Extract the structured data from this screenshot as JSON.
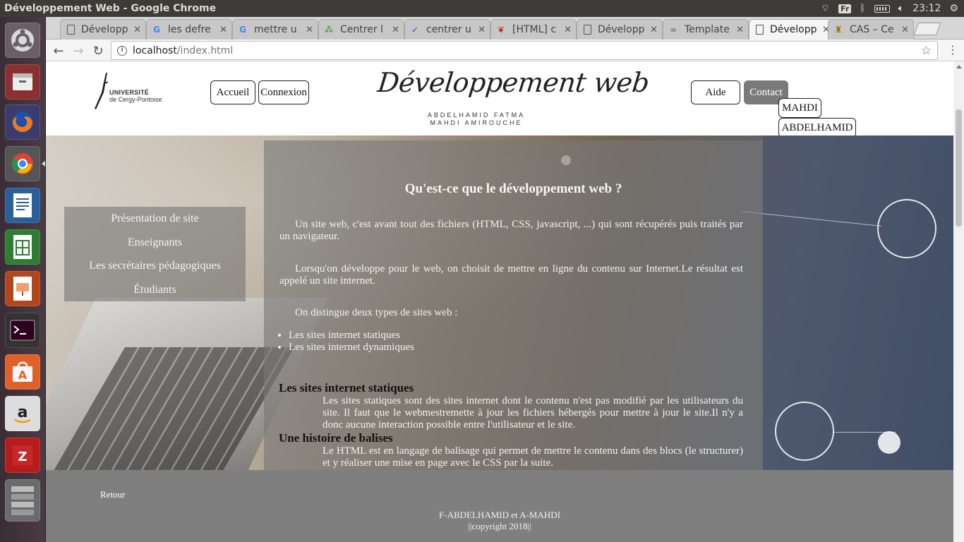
{
  "os": {
    "window_title": "Développement Web - Google Chrome",
    "keyboard_layout": "Fr",
    "clock": "23:12"
  },
  "browser": {
    "tabs": [
      {
        "label": "Développ",
        "icon": "document-icon",
        "active": false
      },
      {
        "label": "les defre",
        "icon": "google-icon",
        "active": false
      },
      {
        "label": "mettre u",
        "icon": "google-icon",
        "active": false
      },
      {
        "label": "Centrer l",
        "icon": "dots-icon",
        "active": false
      },
      {
        "label": "centrer u",
        "icon": "check-icon",
        "active": false
      },
      {
        "label": "[HTML] c",
        "icon": "feather-icon",
        "active": false
      },
      {
        "label": "Développ",
        "icon": "document-icon",
        "active": false
      },
      {
        "label": "Template",
        "icon": "mask-icon",
        "active": false
      },
      {
        "label": "Développ",
        "icon": "document-icon",
        "active": true
      },
      {
        "label": "CAS – Ce",
        "icon": "castle-icon",
        "active": false
      }
    ],
    "address": {
      "host": "localhost",
      "path": "/index.html"
    }
  },
  "site": {
    "logo": {
      "line1": "UNIVERSITÉ",
      "line2": "de Cergy-Pontoise"
    },
    "nav_left": {
      "home": "Accueil",
      "login": "Connexion"
    },
    "brand_title": "Développement web",
    "authors": [
      "ABDELHAMID FATMA",
      "MAHDI AMIROUCHE"
    ],
    "nav_right": {
      "help": "Aide",
      "contact": "Contact",
      "user1": "MAHDI",
      "user2": "ABDELHAMID"
    },
    "side_menu": [
      "Présentation de site",
      "Enseignants",
      "Les secrétaires pédagogiques",
      "Étudiants"
    ],
    "content": {
      "heading": "Qu'est-ce que le développement web ?",
      "p1": "Un site web, c'est avant tout des fichiers (HTML, CSS, javascript, ...) qui sont récupérés puis traités par un navigateur.",
      "p2": "Lorsqu'on développe pour le web, on choisit de mettre en ligne du contenu sur Internet.Le résultat est appelé un site internet.",
      "p3": "On distingue deux types de sites web :",
      "list": [
        "Les sites internet statiques",
        "Les sites internet dynamiques"
      ],
      "h_static": "Les sites internet statiques",
      "static_text": "Les sites statiques sont des sites internet dont le contenu n'est pas modifié par les utilisateurs du site. Il faut que le webmestremette à jour les fichiers hébergés pour mettre à jour le site.Il n'y a donc aucune interaction possible entre l'utilisateur et le site.",
      "h_tags": "Une histoire de balises",
      "tags_text": "Le HTML est en langage de balisage qui permet de mettre le contenu dans des blocs (le structurer) et y réaliser une mise en page avec le CSS par la suite."
    },
    "footer": {
      "back": "Retour",
      "credits": "F-ABDELHAMID et A-MAHDI",
      "copyright": "||copyright 2018||"
    }
  }
}
